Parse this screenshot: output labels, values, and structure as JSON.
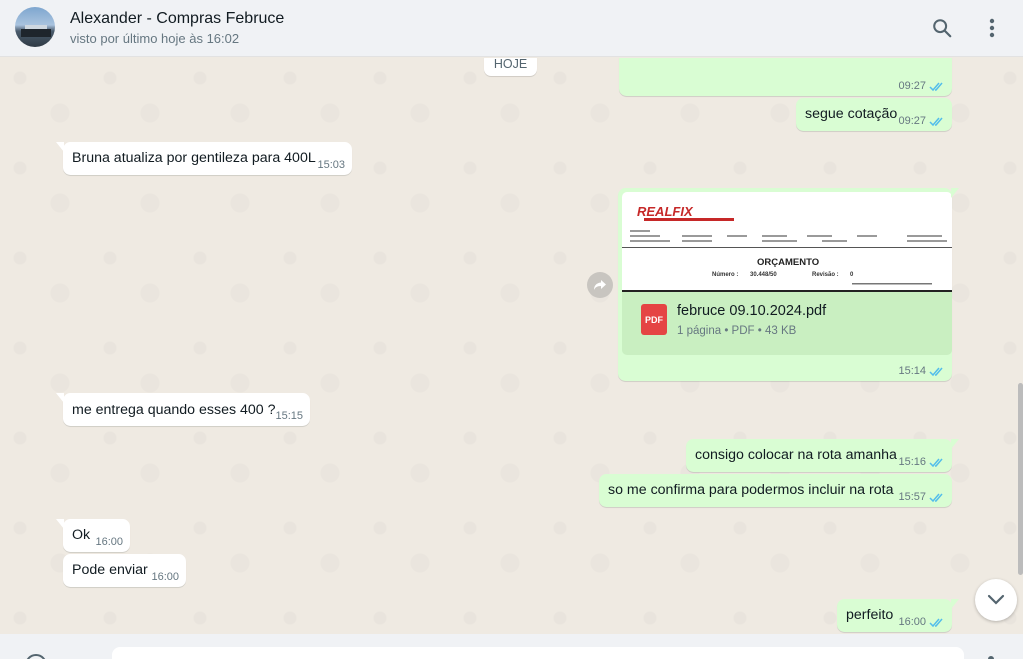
{
  "header": {
    "contact_name": "Alexander - Compras Februce",
    "last_seen": "visto por último hoje às 16:02"
  },
  "chat": {
    "date_divider": "HOJE",
    "messages": [
      {
        "direction": "out",
        "text": "",
        "time": "09:27",
        "status": "read"
      },
      {
        "direction": "out",
        "text": "segue cotação",
        "time": "09:27",
        "status": "read"
      },
      {
        "direction": "in",
        "text": "Bruna atualiza por gentileza para 400L",
        "time": "15:03"
      },
      {
        "direction": "out",
        "type": "document",
        "time": "15:14",
        "status": "read"
      },
      {
        "direction": "in",
        "text": "me entrega quando esses 400 ?",
        "time": "15:15"
      },
      {
        "direction": "out",
        "text": "consigo colocar na rota amanha",
        "time": "15:16",
        "status": "read"
      },
      {
        "direction": "out",
        "text": "so me confirma para podermos incluir na rota",
        "time": "15:57",
        "status": "read"
      },
      {
        "direction": "in",
        "text": "Ok",
        "time": "16:00"
      },
      {
        "direction": "in",
        "text": "Pode enviar",
        "time": "16:00"
      },
      {
        "direction": "out",
        "text": "perfeito",
        "time": "16:00",
        "status": "read"
      }
    ],
    "document": {
      "file_name": "februce 09.10.2024.pdf",
      "file_info": "1 página • PDF • 43 KB",
      "badge": "PDF",
      "preview_logo": "REALFIX",
      "preview_title": "ORÇAMENTO",
      "preview_number_label": "Número :",
      "preview_number": "30.448/50",
      "preview_revision_label": "Revisão :",
      "preview_revision": "0"
    }
  },
  "colors": {
    "outgoing_bubble": "#d9fdd3",
    "incoming_bubble": "#ffffff",
    "read_ticks": "#53bdeb",
    "chat_background": "#efeae2",
    "header_background": "#f0f2f5"
  },
  "icons": {
    "search": "search-icon",
    "menu": "kebab-menu-icon",
    "forward": "forward-icon",
    "scroll_down": "chevron-down-icon",
    "read_status": "double-check-icon"
  }
}
